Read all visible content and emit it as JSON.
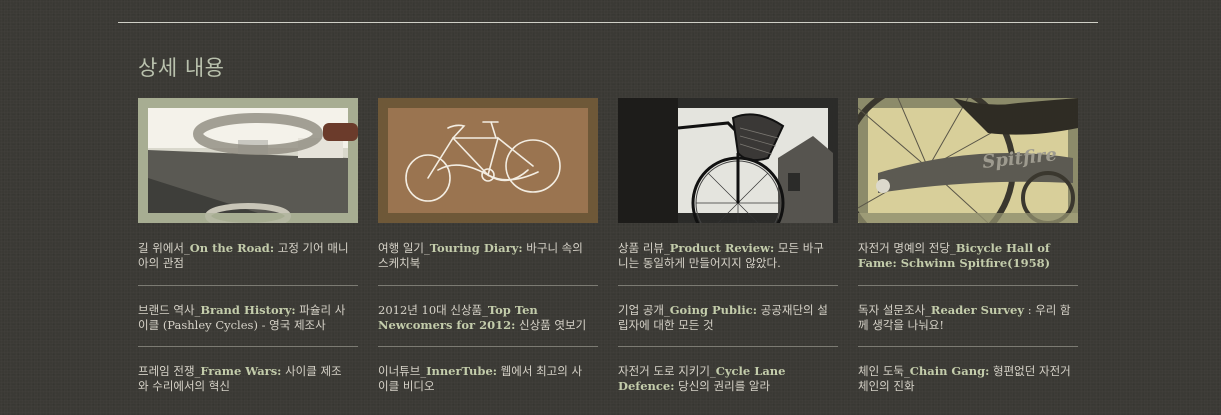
{
  "section": {
    "title": "상세 내용"
  },
  "columns": [
    {
      "thumb_alt": "road-photo",
      "entries": [
        {
          "ko_pre": "길 위에서_",
          "en": "On the Road:",
          "ko_post": " 고정 기어 매니아의 관점"
        },
        {
          "ko_pre": "브랜드 역사_",
          "en": "Brand History:",
          "ko_post": " 파슐리 사이클 (Pashley Cycles) - 영국 제조사",
          "en_extra": ""
        },
        {
          "ko_pre": "프레임 전쟁_",
          "en": "Frame Wars:",
          "ko_post": " 사이클 제조와 수리에서의 혁신"
        }
      ]
    },
    {
      "thumb_alt": "bicycle-drawing",
      "entries": [
        {
          "ko_pre": "여행 일기_",
          "en": "Touring Diary:",
          "ko_post": " 바구니 속의 스케치북"
        },
        {
          "ko_pre": "2012년 10대 신상품_",
          "en": "Top Ten Newcomers for 2012:",
          "ko_post": " 신상품 엿보기"
        },
        {
          "ko_pre": "이너튜브_",
          "en": "InnerTube:",
          "ko_post": " 웹에서 최고의 사이클 비디오"
        }
      ]
    },
    {
      "thumb_alt": "basket-bicycle-photo",
      "entries": [
        {
          "ko_pre": "상품 리뷰_",
          "en": "Product Review:",
          "ko_post": " 모든 바구니는 동일하게 만들어지지 않았다."
        },
        {
          "ko_pre": "기업 공개_",
          "en": "Going Public:",
          "ko_post": " 공공재단의 설립자에 대한 모든 것"
        },
        {
          "ko_pre": "자전거 도로 지키기_",
          "en": "Cycle Lane Defence:",
          "ko_post": " 당신의 권리를 알라"
        }
      ]
    },
    {
      "thumb_alt": "spitfire-bicycle-photo",
      "entries": [
        {
          "ko_pre": "자전거 명예의 전당_",
          "en": "Bicycle Hall of Fame: Schwinn Spitfire(1958)",
          "ko_post": ""
        },
        {
          "ko_pre": "독자 설문조사_",
          "en": "Reader Survey",
          "ko_post": " : 우리 함께 생각을 나눠요!"
        },
        {
          "ko_pre": "체인 도둑_",
          "en": "Chain Gang:",
          "ko_post": " 형편없던 자전거 체인의 진화"
        }
      ]
    }
  ],
  "thumb_text": {
    "spitfire_logo": "Spitfire"
  },
  "colors": {
    "background": "#3b3a35",
    "accent_text": "#c3ccab",
    "body_text": "#d6d2c8",
    "title": "#b9c1ad"
  }
}
